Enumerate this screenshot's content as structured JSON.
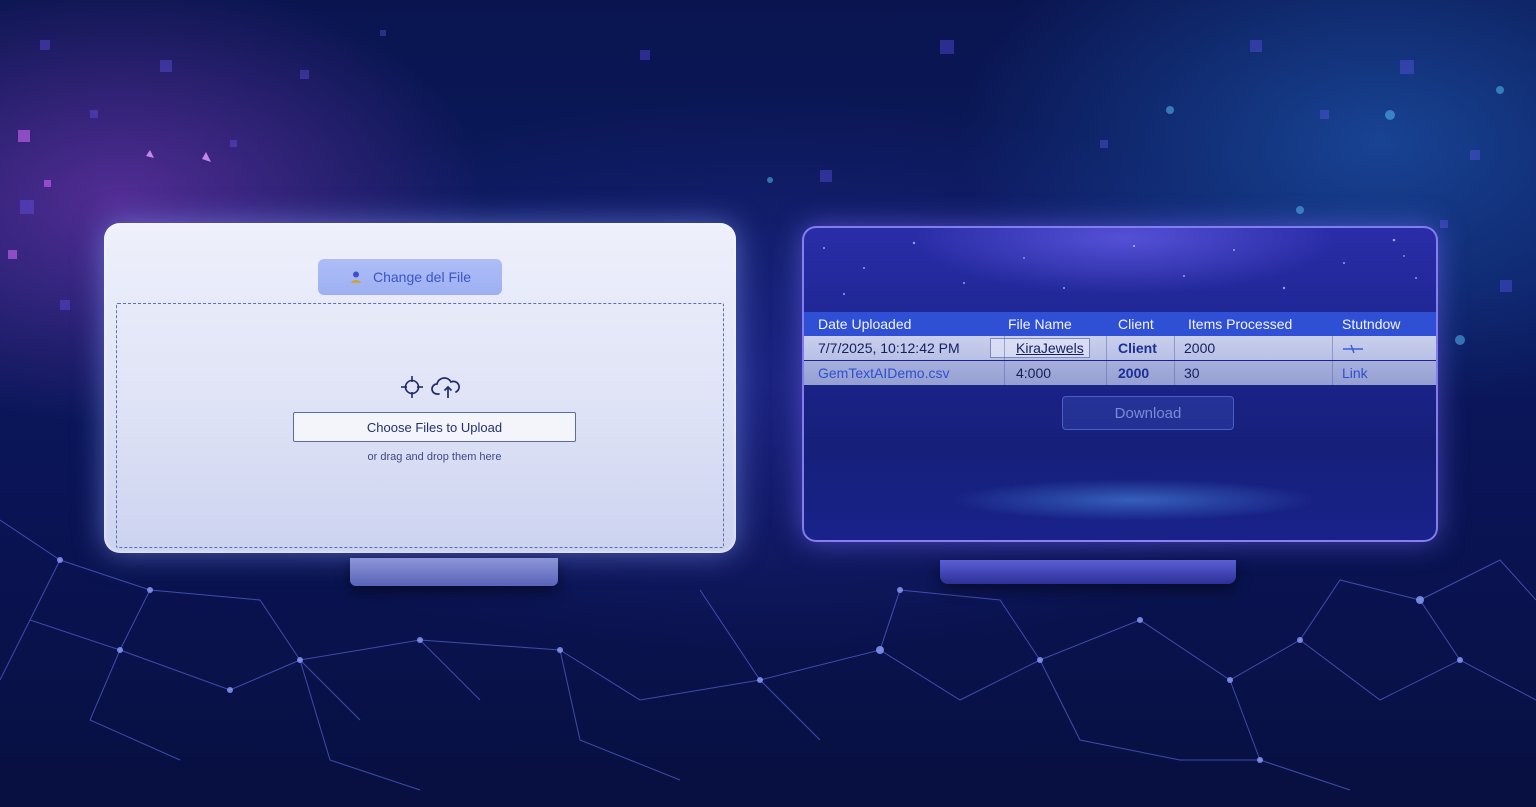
{
  "upload_panel": {
    "change_file_label": "Change del File",
    "choose_files_label": "Choose Files to Upload",
    "drag_drop_text": "or drag and drop them here"
  },
  "history_panel": {
    "columns": [
      "Date Uploaded",
      "File Name",
      "Client",
      "Items Processed",
      "Stutndow"
    ],
    "rows": [
      [
        "7/7/2025, 10:12:42 PM",
        "KiraJewels",
        "Client",
        "2000",
        ""
      ],
      [
        "GemTextAIDemo.csv",
        "4:000",
        "2000",
        "30",
        "Link"
      ]
    ],
    "download_label": "Download"
  },
  "colors": {
    "accent": "#2f4fd4",
    "link": "#2e4fd0",
    "background": "#0b1a5e"
  }
}
